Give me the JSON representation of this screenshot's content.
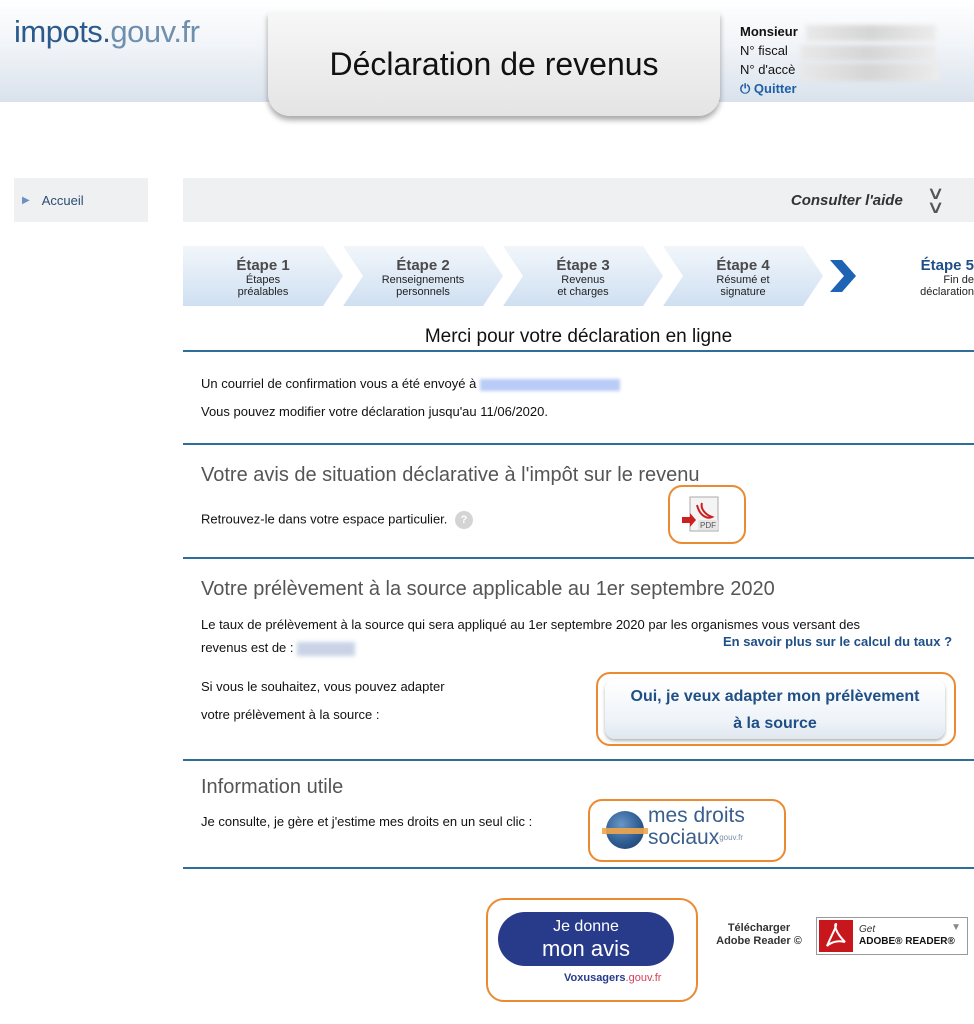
{
  "header": {
    "logo_main": "impots.",
    "logo_domain": "gouv.fr",
    "page_title": "Déclaration de revenus",
    "user_prefix": "Monsieur",
    "fiscal_label": "N° fiscal",
    "access_label": "N° d'accè",
    "quit_label": "Quitter"
  },
  "nav": {
    "home_label": "Accueil"
  },
  "help": {
    "label": "Consulter l'aide"
  },
  "steps": [
    {
      "title": "Étape 1",
      "line1": "Étapes",
      "line2": "préalables"
    },
    {
      "title": "Étape 2",
      "line1": "Renseignements",
      "line2": "personnels"
    },
    {
      "title": "Étape 3",
      "line1": "Revenus",
      "line2": "et charges"
    },
    {
      "title": "Étape 4",
      "line1": "Résumé et",
      "line2": "signature"
    },
    {
      "title": "Étape 5",
      "line1": "Fin de",
      "line2": "déclaration"
    }
  ],
  "main": {
    "thanks": "Merci pour votre déclaration en ligne",
    "confirm_text": "Un courriel de confirmation vous a été envoyé à",
    "modify_text": "Vous pouvez modifier votre déclaration jusqu'au 11/06/2020."
  },
  "avis": {
    "title": "Votre avis de situation déclarative à l'impôt sur le revenu",
    "text": "Retrouvez-le dans votre espace particulier.",
    "help_glyph": "?",
    "pdf_label": "PDF"
  },
  "prelevement": {
    "title": "Votre prélèvement à la source applicable au 1er septembre 2020",
    "text_line1": "Le taux de prélèvement à la source qui sera appliqué au 1er septembre 2020 par les organismes vous versant des",
    "text_line2": "revenus est de :",
    "more_link": "En savoir plus sur le calcul du taux ?",
    "adapt_line1": "Si vous le souhaitez, vous pouvez adapter",
    "adapt_line2": "votre prélèvement à la source :",
    "button_line1": "Oui, je veux adapter mon prélèvement",
    "button_line2": "à la source"
  },
  "info": {
    "title": "Information utile",
    "text": "Je consulte, je gère et j'estime mes droits en un seul clic :",
    "logo_line1": "mes droits",
    "logo_line2": "sociaux",
    "logo_gouv": "gouv.fr"
  },
  "footer": {
    "avis_line1": "Je donne",
    "avis_line2": "mon avis",
    "vox_main": "Voxusagers",
    "vox_tld": ".gouv.fr",
    "download_line1": "Télécharger",
    "download_line2": "Adobe Reader ©",
    "reader_get": "Get",
    "reader_name": "ADOBE® READER®"
  },
  "colors": {
    "accent": "#1f4f86",
    "rule": "#2e6f9a",
    "highlight_border": "#ec8a32"
  }
}
